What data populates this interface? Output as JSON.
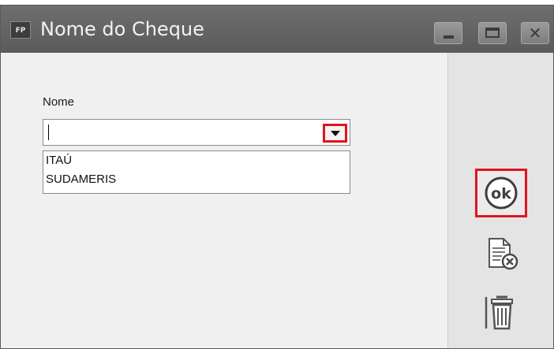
{
  "window": {
    "title": "Nome do Cheque",
    "app_icon_text": "FP",
    "controls": {
      "minimize": "minimize-icon",
      "maximize": "maximize-icon",
      "close": "close-icon"
    }
  },
  "form": {
    "name_label": "Nome",
    "name_value": "",
    "dropdown_icon": "chevron-down-icon",
    "options": [
      "ITAÚ",
      "SUDAMERIS"
    ]
  },
  "actions": {
    "ok_text": "ok",
    "ok_icon": "ok-circle-icon",
    "cancel_icon": "document-cancel-icon",
    "delete_icon": "trash-icon"
  },
  "colors": {
    "titlebar": "#616161",
    "highlight": "#e0141e",
    "content_bg": "#f0f0f0",
    "sidebar_bg": "#e4e4e4"
  }
}
